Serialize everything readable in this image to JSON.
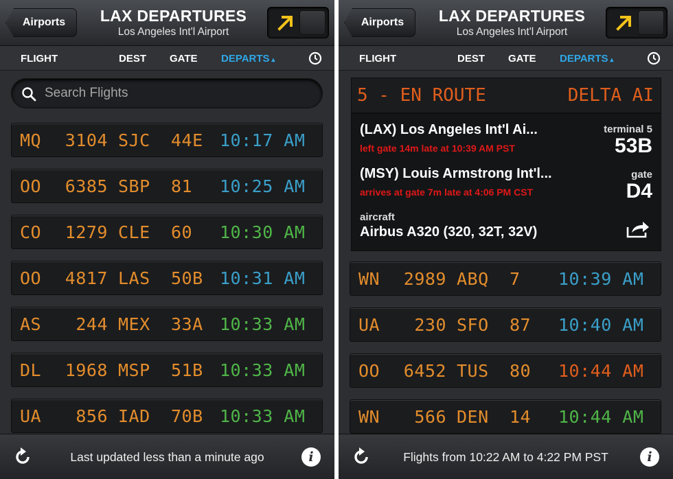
{
  "colors": {
    "amber": "#e38d2c",
    "blue": "#3a9fc9",
    "green": "#4fb548",
    "orange_red": "#e05e1c",
    "late_red": "#e01818",
    "accent": "#2fa7e6"
  },
  "left": {
    "header": {
      "back_label": "Airports",
      "title": "LAX DEPARTURES",
      "subtitle": "Los Angeles Int'l Airport"
    },
    "columns": {
      "flight": "FLIGHT",
      "dest": "DEST",
      "gate": "GATE",
      "departs": "DEPARTS"
    },
    "search": {
      "placeholder": "Search Flights"
    },
    "flights": [
      {
        "airline": "MQ",
        "number": "3104",
        "dest": "SJC",
        "gate": "44E",
        "time": "10:17 AM",
        "time_color": "blue"
      },
      {
        "airline": "OO",
        "number": "6385",
        "dest": "SBP",
        "gate": "81",
        "time": "10:25 AM",
        "time_color": "blue"
      },
      {
        "airline": "CO",
        "number": "1279",
        "dest": "CLE",
        "gate": "60",
        "time": "10:30 AM",
        "time_color": "green"
      },
      {
        "airline": "OO",
        "number": "4817",
        "dest": "LAS",
        "gate": "50B",
        "time": "10:31 AM",
        "time_color": "blue"
      },
      {
        "airline": "AS",
        "number": "244",
        "dest": "MEX",
        "gate": "33A",
        "time": "10:33 AM",
        "time_color": "green"
      },
      {
        "airline": "DL",
        "number": "1968",
        "dest": "MSP",
        "gate": "51B",
        "time": "10:33 AM",
        "time_color": "green"
      },
      {
        "airline": "UA",
        "number": "856",
        "dest": "IAD",
        "gate": "70B",
        "time": "10:33 AM",
        "time_color": "green"
      }
    ],
    "footer": {
      "text": "Last updated less than a minute ago"
    }
  },
  "right": {
    "header": {
      "back_label": "Airports",
      "title": "LAX DEPARTURES",
      "subtitle": "Los Angeles Int'l Airport"
    },
    "columns": {
      "flight": "FLIGHT",
      "dest": "DEST",
      "gate": "GATE",
      "departs": "DEPARTS"
    },
    "detail": {
      "status": "5 - EN ROUTE",
      "airline": "DELTA AI",
      "origin": "(LAX) Los Angeles Int'l Ai...",
      "origin_note": "left gate 14m late at 10:39 AM PST",
      "origin_terminal_label": "terminal 5",
      "origin_gate": "53B",
      "destination": "(MSY) Louis Armstrong Int'l...",
      "destination_note": "arrives at gate 7m late at 4:06 PM CST",
      "destination_gate_label": "gate",
      "destination_gate": "D4",
      "aircraft_label": "aircraft",
      "aircraft": "Airbus A320 (320, 32T, 32V)"
    },
    "flights": [
      {
        "airline": "WN",
        "number": "2989",
        "dest": "ABQ",
        "gate": "7",
        "time": "10:39 AM",
        "time_color": "blue"
      },
      {
        "airline": "UA",
        "number": "230",
        "dest": "SFO",
        "gate": "87",
        "time": "10:40 AM",
        "time_color": "blue"
      },
      {
        "airline": "OO",
        "number": "6452",
        "dest": "TUS",
        "gate": "80",
        "time": "10:44 AM",
        "time_color": "orange_red"
      },
      {
        "airline": "WN",
        "number": "566",
        "dest": "DEN",
        "gate": "14",
        "time": "10:44 AM",
        "time_color": "green"
      }
    ],
    "footer": {
      "text": "Flights from 10:22 AM to 4:22 PM PST"
    }
  }
}
